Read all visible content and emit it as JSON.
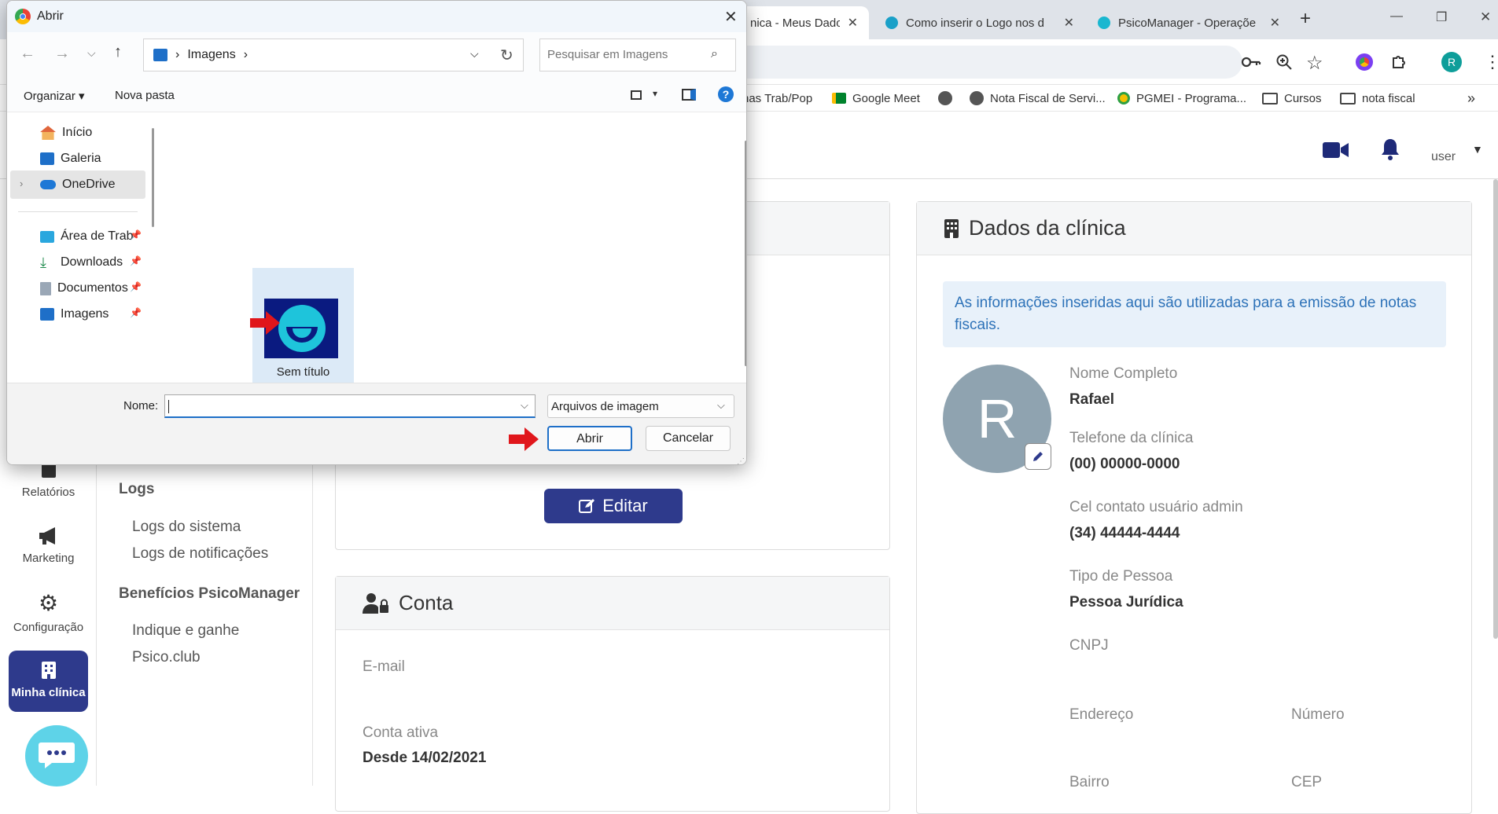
{
  "browser": {
    "tabs": [
      {
        "title": "nica - Meus Dado"
      },
      {
        "title": "Como inserir o Logo nos d"
      },
      {
        "title": "PsicoManager - Operaçõe"
      }
    ],
    "new_tab": "+",
    "profile_initial": "R",
    "bookmarks": [
      {
        "label": "has Trab/Pop"
      },
      {
        "label": "Google Meet"
      },
      {
        "label": "Nota Fiscal de Servi..."
      },
      {
        "label": "PGMEI - Programa..."
      },
      {
        "label": "Cursos"
      },
      {
        "label": "nota fiscal"
      }
    ]
  },
  "app": {
    "avatar_alt": "user",
    "rail": [
      {
        "label": "Relatórios"
      },
      {
        "label": "Marketing"
      },
      {
        "label": "Configuração"
      },
      {
        "label": "Minha clínica"
      }
    ],
    "submenu": {
      "logs_heading": "Logs",
      "logs_items": [
        "Logs do sistema",
        "Logs de notificações"
      ],
      "benefits_heading": "Benefícios PsicoManager",
      "benefits_items": [
        "Indique e ganhe",
        "Psico.club"
      ]
    },
    "edit_button": "Editar",
    "account": {
      "title": "Conta",
      "email_label": "E-mail",
      "email_value": "",
      "active_label": "Conta ativa",
      "active_value": "Desde 14/02/2021"
    },
    "clinic": {
      "title": "Dados da clínica",
      "info": "As informações inseridas aqui são utilizadas para a emissão de notas fiscais.",
      "avatar_letter": "R",
      "fields": [
        {
          "label": "Nome Completo",
          "value": "Rafael"
        },
        {
          "label": "Telefone da clínica",
          "value": "(00) 00000-0000"
        },
        {
          "label": "Cel contato usuário admin",
          "value": "(34) 44444-4444"
        },
        {
          "label": "Tipo de Pessoa",
          "value": "Pessoa Jurídica"
        },
        {
          "label": "CNPJ",
          "value": ""
        }
      ],
      "address_label": "Endereço",
      "number_label": "Número",
      "bairro_label": "Bairro",
      "cep_label": "CEP"
    }
  },
  "dialog": {
    "title": "Abrir",
    "path_folder": "Imagens",
    "search_placeholder": "Pesquisar em Imagens",
    "organize": "Organizar",
    "new_folder": "Nova pasta",
    "nav_items": [
      {
        "label": "Início",
        "icon": "home-icon"
      },
      {
        "label": "Galeria",
        "icon": "gallery-icon"
      },
      {
        "label": "OneDrive",
        "icon": "cloud-icon"
      },
      {
        "label": "Área de Trab",
        "icon": "desktop-icon"
      },
      {
        "label": "Downloads",
        "icon": "download-icon"
      },
      {
        "label": "Documentos",
        "icon": "document-icon"
      },
      {
        "label": "Imagens",
        "icon": "pictures-icon"
      }
    ],
    "file": {
      "name": "Sem título"
    },
    "name_label": "Nome:",
    "name_value": "",
    "filter_value": "Arquivos de imagem",
    "open_button": "Abrir",
    "cancel_button": "Cancelar"
  },
  "colors": {
    "brand_navy": "#2e3a8c",
    "annotation_red": "#e0161b",
    "info_bg": "#e8f1fa",
    "info_text": "#2d72b8",
    "avatar_gray": "#8fa3b0"
  }
}
